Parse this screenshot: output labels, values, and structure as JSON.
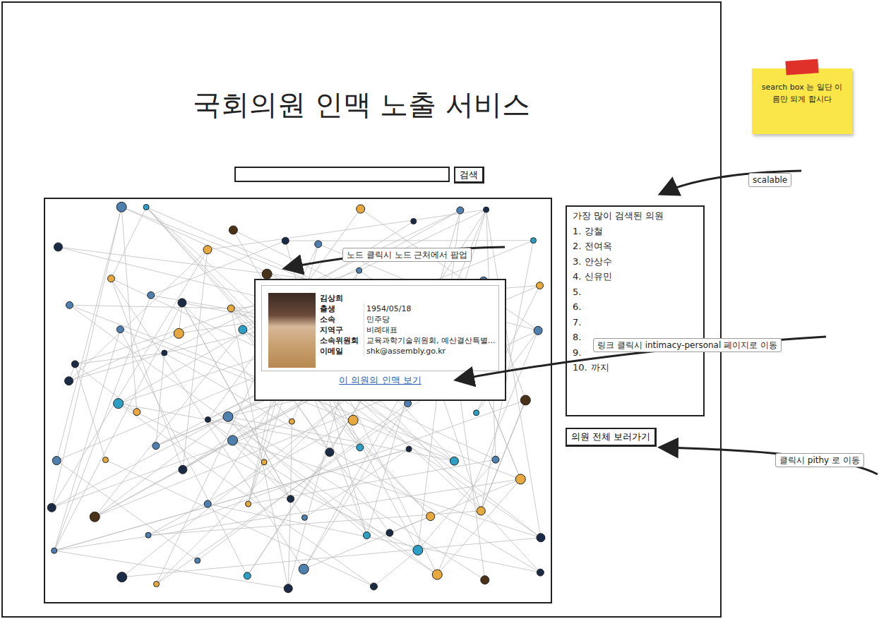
{
  "title": "국회의원 인맥 노출 서비스",
  "search": {
    "value": "",
    "button": "검색"
  },
  "graph": {
    "nodes": [
      {
        "color": "#1b2b45"
      },
      {
        "color": "#4f7fae"
      },
      {
        "color": "#2e9fc4"
      },
      {
        "color": "#e7a83e"
      },
      {
        "color": "#4a3218"
      },
      {
        "color": "#1b2b45"
      },
      {
        "color": "#4f7fae"
      },
      {
        "color": "#e7a83e"
      },
      {
        "color": "#1b2b45"
      },
      {
        "color": "#4f7fae"
      },
      {
        "color": "#1b2b45"
      },
      {
        "color": "#2e9fc4"
      },
      {
        "color": "#4f7fae"
      },
      {
        "color": "#e7a83e"
      },
      {
        "color": "#4f7fae"
      },
      {
        "color": "#1b2b45"
      },
      {
        "color": "#e7a83e"
      },
      {
        "color": "#4a3218"
      },
      {
        "color": "#1b2b45"
      },
      {
        "color": "#4f7fae"
      },
      {
        "color": "#2e9fc4"
      },
      {
        "color": "#1b2b45"
      },
      {
        "color": "#4f7fae"
      },
      {
        "color": "#e7a83e"
      },
      {
        "color": "#1b2b45"
      },
      {
        "color": "#4f7fae"
      },
      {
        "color": "#1b2b45"
      },
      {
        "color": "#e7a83e"
      },
      {
        "color": "#2e9fc4"
      },
      {
        "color": "#e7a83e"
      },
      {
        "color": "#1b2b45"
      },
      {
        "color": "#4f7fae"
      },
      {
        "color": "#4a3218"
      },
      {
        "color": "#1b2b45"
      },
      {
        "color": "#4f7fae"
      },
      {
        "color": "#4f7fae"
      },
      {
        "color": "#1b2b45"
      },
      {
        "color": "#2e9fc4"
      },
      {
        "color": "#e7a83e"
      },
      {
        "color": "#1b2b45"
      },
      {
        "color": "#4f7fae"
      },
      {
        "color": "#e7a83e"
      },
      {
        "color": "#1b2b45"
      },
      {
        "color": "#e7a83e"
      },
      {
        "color": "#4f7fae"
      },
      {
        "color": "#1b2b45"
      },
      {
        "color": "#2e9fc4"
      },
      {
        "color": "#4a3218"
      },
      {
        "color": "#4f7fae"
      },
      {
        "color": "#e7a83e"
      },
      {
        "color": "#4f7fae"
      },
      {
        "color": "#1b2b45"
      },
      {
        "color": "#4f7fae"
      },
      {
        "color": "#e7a83e"
      },
      {
        "color": "#1b2b45"
      },
      {
        "color": "#2e9fc4"
      },
      {
        "color": "#1b2b45"
      },
      {
        "color": "#2e9fc4"
      },
      {
        "color": "#4f7fae"
      },
      {
        "color": "#e7a83e"
      },
      {
        "color": "#1b2b45"
      },
      {
        "color": "#4a3218"
      },
      {
        "color": "#4f7fae"
      },
      {
        "color": "#4f7fae"
      },
      {
        "color": "#e7a83e"
      },
      {
        "color": "#1b2b45"
      },
      {
        "color": "#4f7fae"
      },
      {
        "color": "#2e9fc4"
      },
      {
        "color": "#1b2b45"
      },
      {
        "color": "#e7a83e"
      },
      {
        "color": "#e7a83e"
      },
      {
        "color": "#1b2b45"
      },
      {
        "color": "#4f7fae"
      },
      {
        "color": "#1b2b45"
      },
      {
        "color": "#e7a83e"
      },
      {
        "color": "#4f7fae"
      },
      {
        "color": "#2e9fc4"
      },
      {
        "color": "#1b2b45"
      },
      {
        "color": "#4f7fae"
      },
      {
        "color": "#1b2b45"
      },
      {
        "color": "#2e9fc4"
      },
      {
        "color": "#e7a83e"
      },
      {
        "color": "#4a3218"
      },
      {
        "color": "#1b2b45"
      }
    ]
  },
  "popup": {
    "name": "김상희",
    "fields": [
      {
        "label": "출생",
        "value": "1954/05/18"
      },
      {
        "label": "소속",
        "value": "민주당"
      },
      {
        "label": "지역구",
        "value": "비례대표"
      },
      {
        "label": "소속위원회",
        "value": "교육과학기술위원회, 예산결산특별..."
      },
      {
        "label": "이메일",
        "value": "shk@assembly.go.kr"
      }
    ],
    "link": "이 의원의 인맥 보기"
  },
  "ranking": {
    "title": "가장 많이 검색된 의원",
    "items": [
      {
        "rank": "1.",
        "name": "강철"
      },
      {
        "rank": "2.",
        "name": "전여옥"
      },
      {
        "rank": "3.",
        "name": "안상수"
      },
      {
        "rank": "4.",
        "name": "신유민"
      },
      {
        "rank": "5.",
        "name": ""
      },
      {
        "rank": "6.",
        "name": ""
      },
      {
        "rank": "7.",
        "name": ""
      },
      {
        "rank": "8.",
        "name": ""
      },
      {
        "rank": "9.",
        "name": ""
      },
      {
        "rank": "10.",
        "name": "까지"
      }
    ]
  },
  "all_button": "의원 전체 보러가기",
  "annotations": {
    "sticky": "search box 는 일단 이름만 되게 합시다",
    "scalable": "scalable",
    "popup_note": "노드 클릭시 노드 근처에서 팝업",
    "link_note": "링크 클릭시 intimacy-personal 페이지로 이동",
    "pithy_note": "클릭시 pithy 로 이동"
  }
}
